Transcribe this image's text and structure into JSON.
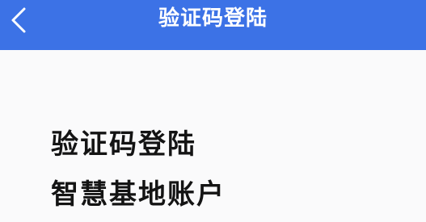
{
  "nav": {
    "title": "验证码登陆",
    "back_icon": "chevron-left-icon"
  },
  "content": {
    "heading": "验证码登陆",
    "subheading": "智慧基地账户"
  },
  "colors": {
    "nav_background": "#3c72e6",
    "nav_text": "#ffffff",
    "page_background": "#fafafb",
    "heading_text": "#141414"
  }
}
